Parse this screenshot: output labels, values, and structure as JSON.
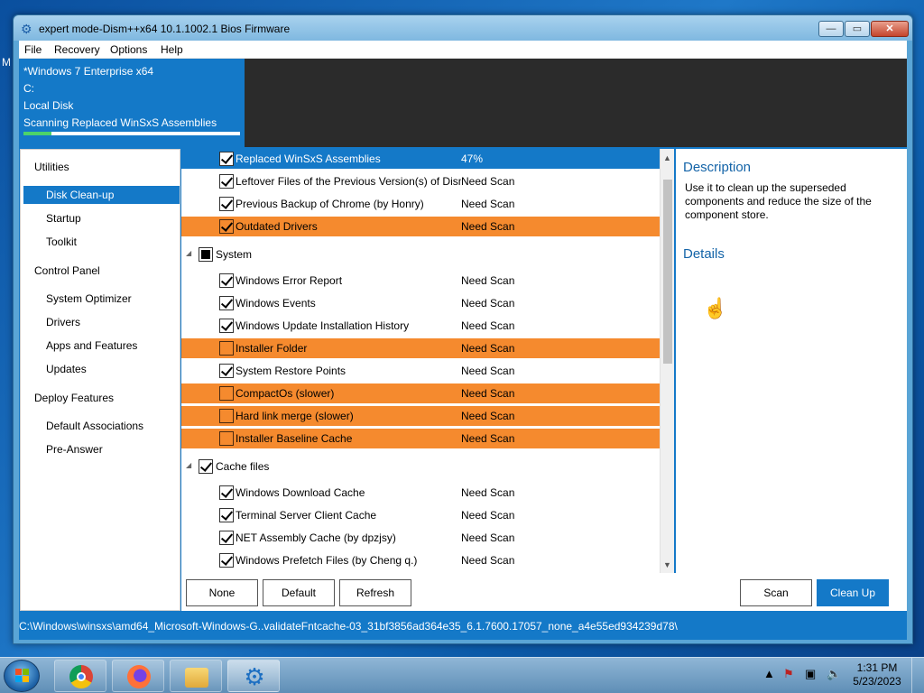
{
  "desktop": {
    "edge_text": "M"
  },
  "window": {
    "title": "expert mode-Dism++x64 10.1.1002.1 Bios Firmware",
    "controls": {
      "minimize": "—",
      "maximize": "▭",
      "close": "✕"
    }
  },
  "menu": [
    "File",
    "Recovery",
    "Options",
    "Help"
  ],
  "info": {
    "os": "*Windows 7 Enterprise x64",
    "drive": "C:",
    "disk": "Local Disk",
    "task": "Scanning Replaced WinSxS Assemblies",
    "progress": 0.13
  },
  "sidebar": {
    "groups": [
      {
        "label": "Utilities",
        "items": [
          "Disk Clean-up",
          "Startup",
          "Toolkit"
        ]
      },
      {
        "label": "Control Panel",
        "items": [
          "System Optimizer",
          "Drivers",
          "Apps and Features",
          "Updates"
        ]
      },
      {
        "label": "Deploy Features",
        "items": [
          "Default Associations",
          "Pre-Answer"
        ]
      }
    ],
    "active": "Disk Clean-up"
  },
  "list": {
    "rows": [
      {
        "label": "Replaced WinSxS Assemblies",
        "status": "47%",
        "checked": true,
        "style": "sel"
      },
      {
        "label": "Leftover Files of the Previous Version(s) of Dism++",
        "status": "Need Scan",
        "checked": true,
        "style": ""
      },
      {
        "label": "Previous Backup of Chrome (by Honry)",
        "status": "Need Scan",
        "checked": true,
        "style": ""
      },
      {
        "label": "Outdated Drivers",
        "status": "Need Scan",
        "checked": true,
        "style": "warn"
      }
    ],
    "groups": [
      {
        "label": "System",
        "state": "partial",
        "rows": [
          {
            "label": "Windows Error Report",
            "status": "Need Scan",
            "checked": true,
            "style": ""
          },
          {
            "label": "Windows Events",
            "status": "Need Scan",
            "checked": true,
            "style": ""
          },
          {
            "label": "Windows Update Installation History",
            "status": "Need Scan",
            "checked": true,
            "style": ""
          },
          {
            "label": "Installer Folder",
            "status": "Need Scan",
            "checked": false,
            "style": "warn"
          },
          {
            "label": "System Restore Points",
            "status": "Need Scan",
            "checked": true,
            "style": ""
          },
          {
            "label": "CompactOs (slower)",
            "status": "Need Scan",
            "checked": false,
            "style": "warn"
          },
          {
            "label": "Hard link merge (slower)",
            "status": "Need Scan",
            "checked": false,
            "style": "warn"
          },
          {
            "label": "Installer Baseline Cache",
            "status": "Need Scan",
            "checked": false,
            "style": "warn"
          }
        ]
      },
      {
        "label": "Cache files",
        "state": "checked",
        "rows": [
          {
            "label": "Windows Download Cache",
            "status": "Need Scan",
            "checked": true,
            "style": ""
          },
          {
            "label": "Terminal Server Client Cache",
            "status": "Need Scan",
            "checked": true,
            "style": ""
          },
          {
            "label": "NET Assembly Cache (by dpzjsy)",
            "status": "Need Scan",
            "checked": true,
            "style": ""
          },
          {
            "label": "Windows Prefetch Files (by Cheng q.)",
            "status": "Need Scan",
            "checked": true,
            "style": ""
          }
        ]
      }
    ]
  },
  "description": {
    "title": "Description",
    "text": "Use it to clean up the superseded components and reduce the size of the component store.",
    "details_title": "Details"
  },
  "buttons": {
    "none": "None",
    "default": "Default",
    "refresh": "Refresh",
    "scan": "Scan",
    "clean_up": "Clean Up"
  },
  "status_path": "C:\\Windows\\winsxs\\amd64_Microsoft-Windows-G..validateFntcache-03_31bf3856ad364e35_6.1.7600.17057_none_a4e55ed934239d78\\",
  "taskbar": {
    "apps": [
      "chrome-icon",
      "firefox-icon",
      "explorer-icon",
      "dism-icon"
    ],
    "clock_time": "1:31 PM",
    "clock_date": "5/23/2023"
  },
  "colors": {
    "accent": "#1479c8",
    "warn_row": "#f58a2e",
    "progress": "#4cd36a"
  }
}
